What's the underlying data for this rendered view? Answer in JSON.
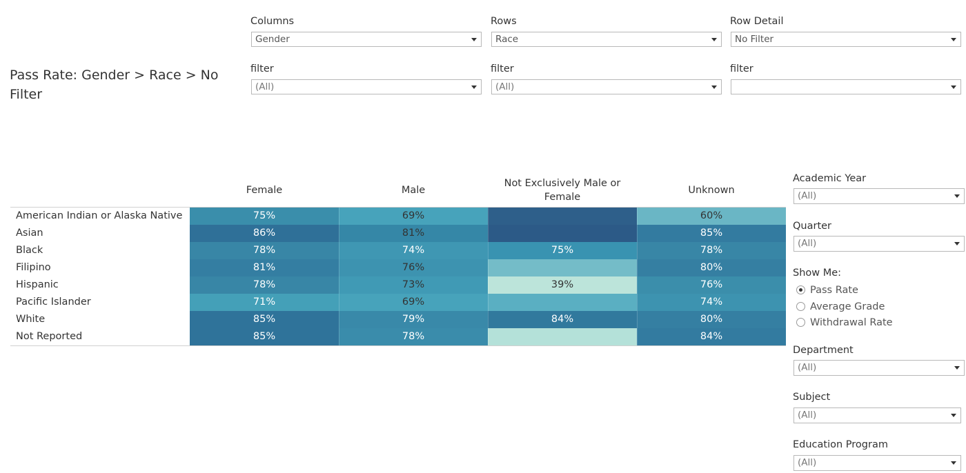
{
  "title": "Pass Rate: Gender > Race > No Filter",
  "controls": {
    "columns": {
      "label": "Columns",
      "value": "Gender"
    },
    "rows": {
      "label": "Rows",
      "value": "Race"
    },
    "row_detail": {
      "label": "Row Detail",
      "value": "No Filter"
    },
    "filter1": {
      "label": "filter",
      "value": "(All)"
    },
    "filter2": {
      "label": "filter",
      "value": "(All)"
    },
    "filter3": {
      "label": "filter",
      "value": ""
    }
  },
  "table": {
    "columns": [
      "Female",
      "Male",
      "Not Exclusively Male or Female",
      "Unknown"
    ],
    "rows": [
      {
        "label": "American Indian or Alaska Native",
        "cells": [
          "75%",
          "69%",
          "",
          "60%"
        ]
      },
      {
        "label": "Asian",
        "cells": [
          "86%",
          "81%",
          "",
          "85%"
        ]
      },
      {
        "label": "Black",
        "cells": [
          "78%",
          "74%",
          "75%",
          "78%"
        ]
      },
      {
        "label": "Filipino",
        "cells": [
          "81%",
          "76%",
          "",
          "80%"
        ]
      },
      {
        "label": "Hispanic",
        "cells": [
          "78%",
          "73%",
          "39%",
          "76%"
        ]
      },
      {
        "label": "Pacific Islander",
        "cells": [
          "71%",
          "69%",
          "",
          "74%"
        ]
      },
      {
        "label": "White",
        "cells": [
          "85%",
          "79%",
          "84%",
          "80%"
        ]
      },
      {
        "label": "Not Reported",
        "cells": [
          "85%",
          "78%",
          "",
          "84%"
        ]
      }
    ],
    "colors": [
      [
        "#3a8eab",
        "#47a3bb",
        "#2e5f8a",
        "#6ab6c5"
      ],
      [
        "#2f7098",
        "#3587a7",
        "#2c5a87",
        "#337ba0"
      ],
      [
        "#3886a6",
        "#3f97b3",
        "#3993b1",
        "#3886a6"
      ],
      [
        "#347ea2",
        "#3d93b0",
        "#74bcc8",
        "#357fa2"
      ],
      [
        "#3886a6",
        "#409ab5",
        "#bce4da",
        "#3b8eab"
      ],
      [
        "#44a0b8",
        "#47a3bb",
        "#5aafc2",
        "#3d93b0"
      ],
      [
        "#2f739a",
        "#3989a9",
        "#31799d",
        "#357fa2"
      ],
      [
        "#2f739a",
        "#3a8cab",
        "#b4e1d9",
        "#337ba0"
      ]
    ],
    "dark_text_cells": [
      [
        0,
        1
      ],
      [
        0,
        3
      ],
      [
        1,
        1
      ],
      [
        3,
        1
      ],
      [
        4,
        1
      ],
      [
        4,
        2
      ],
      [
        5,
        1
      ]
    ]
  },
  "side": {
    "academic_year": {
      "label": "Academic Year",
      "value": "(All)"
    },
    "quarter": {
      "label": "Quarter",
      "value": "(All)"
    },
    "show_me": {
      "label": "Show Me:",
      "options": [
        "Pass Rate",
        "Average Grade",
        "Withdrawal Rate"
      ],
      "selected": "Pass Rate"
    },
    "department": {
      "label": "Department",
      "value": "(All)"
    },
    "subject": {
      "label": "Subject",
      "value": "(All)"
    },
    "education_program": {
      "label": "Education Program",
      "value": "(All)"
    }
  }
}
